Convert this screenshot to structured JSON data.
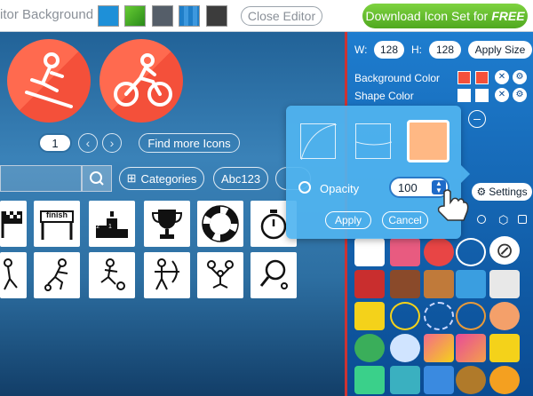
{
  "topbar": {
    "label": "itor Background",
    "close_label": "Close Editor",
    "download_label": "Download Icon Set for",
    "download_emphasis": "FREE",
    "swatches": [
      "#1e90d8",
      "#3fae2a",
      "#444b55",
      "#1f7ec8",
      "#3c3c3c"
    ]
  },
  "pager": {
    "page": "1",
    "prev_icon": "chevron-left-icon",
    "next_icon": "chevron-right-icon",
    "find_more": "Find more Icons"
  },
  "search": {
    "categories_label": "Categories",
    "abc_label": "Abc123"
  },
  "tiles_row1": [
    "finish-flag-icon",
    "finish-line-icon",
    "podium-icon",
    "trophy-icon",
    "lifebuoy-icon",
    "stopwatch-icon"
  ],
  "tiles_row2": [
    "person-icon",
    "skating-icon",
    "soccer-icon",
    "archery-icon",
    "gymnastics-icon",
    "table-tennis-icon"
  ],
  "podium_text": "2 1 3",
  "finish_text": "finish",
  "right_panel": {
    "w_label": "W:",
    "w_value": "128",
    "h_label": "H:",
    "h_value": "128",
    "apply_size": "Apply Size",
    "bg_color_label": "Background Color",
    "shape_color_label": "Shape Color",
    "settings_label": "Settings"
  },
  "popup": {
    "opacity_label": "Opacity",
    "opacity_value": "100",
    "apply_label": "Apply",
    "cancel_label": "Cancel"
  },
  "colors": {
    "accent_red": "#f4503a",
    "green_btn": "#5cb82a",
    "panel_blue": "#1e7dcf"
  }
}
